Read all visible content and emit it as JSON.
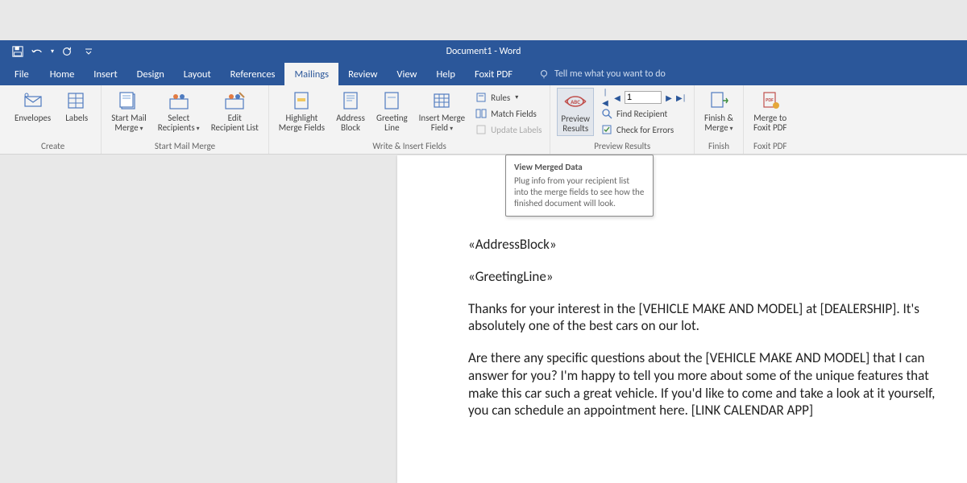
{
  "titlebar": {
    "title": "Document1  -  Word"
  },
  "tabs": {
    "file": "File",
    "items": [
      "Home",
      "Insert",
      "Design",
      "Layout",
      "References",
      "Mailings",
      "Review",
      "View",
      "Help",
      "Foxit PDF"
    ],
    "active": "Mailings",
    "tellme": "Tell me what you want to do"
  },
  "ribbon": {
    "create": {
      "label": "Create",
      "envelopes": "Envelopes",
      "labels": "Labels"
    },
    "start": {
      "label": "Start Mail Merge",
      "start": "Start Mail\nMerge",
      "select": "Select\nRecipients",
      "edit": "Edit\nRecipient List"
    },
    "write": {
      "label": "Write & Insert Fields",
      "highlight": "Highlight\nMerge Fields",
      "address": "Address\nBlock",
      "greeting": "Greeting\nLine",
      "insert": "Insert Merge\nField",
      "rules": "Rules",
      "match": "Match Fields",
      "update": "Update Labels"
    },
    "preview": {
      "label": "Preview Results",
      "preview": "Preview\nResults",
      "record": "1",
      "find": "Find Recipient",
      "check": "Check for Errors"
    },
    "finish": {
      "label": "Finish",
      "finish": "Finish &\nMerge"
    },
    "foxit": {
      "label": "Foxit PDF",
      "merge": "Merge to\nFoxit PDF"
    }
  },
  "tooltip": {
    "title": "View Merged Data",
    "body": "Plug info from your recipient list into the merge fields to see how the finished document will look."
  },
  "document": {
    "p1": "«AddressBlock»",
    "p2": "«GreetingLine»",
    "p3": "Thanks for your interest in the [VEHICLE MAKE AND MODEL] at [DEALERSHIP]. It's absolutely one of the best cars on our lot.",
    "p4": "Are there any specific questions about the [VEHICLE MAKE AND MODEL] that I can answer for you? I'm happy to tell you more about some of the unique features that make this car such a great vehicle. If you'd like to come and take a look at it yourself, you can schedule an appointment here. [LINK CALENDAR APP]"
  }
}
